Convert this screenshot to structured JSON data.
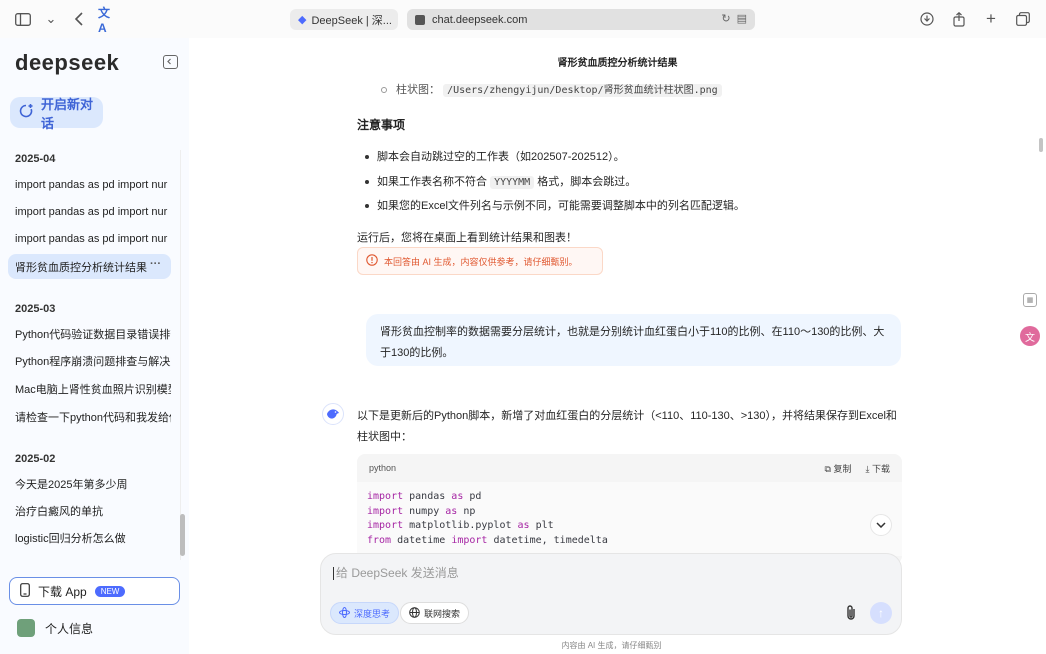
{
  "browser": {
    "tab_inactive_label": "DeepSeek | 深...",
    "tab_active_url": "chat.deepseek.com"
  },
  "sidebar": {
    "logo": "deepseek",
    "new_chat_label": "开启新对话",
    "groups": [
      {
        "title": "2025-04",
        "items": [
          "import pandas as pd import nur",
          "import pandas as pd import nur",
          "import pandas as pd import nur",
          "肾形贫血质控分析统计结果"
        ]
      },
      {
        "title": "2025-03",
        "items": [
          "Python代码验证数据目录错误排查",
          "Python程序崩溃问题排查与解决方",
          "Mac电脑上肾性贫血照片识别模型",
          "请检查一下python代码和我发给你"
        ]
      },
      {
        "title": "2025-02",
        "items": [
          "今天是2025年第多少周",
          "治疗白癜风的单抗",
          "logistic回归分析怎么做"
        ]
      }
    ],
    "active_more": "···",
    "download_app_label": "下载 App",
    "new_badge": "NEW",
    "profile_label": "个人信息"
  },
  "main": {
    "chat_title": "肾形贫血质控分析统计结果",
    "bar_chart_label": "柱状图：",
    "bar_chart_path": "/Users/zhengyijun/Desktop/肾形贫血统计柱状图.png",
    "notes_heading": "注意事项",
    "notes": [
      {
        "text_a": "脚本会自动跳过空的工作表（如202507-202512）。",
        "code": "",
        "text_b": ""
      },
      {
        "text_a": "如果工作表名称不符合 ",
        "code": "YYYYMM",
        "text_b": " 格式，脚本会跳过。"
      },
      {
        "text_a": "如果您的Excel文件列名与示例不同，可能需要调整脚本中的列名匹配逻辑。",
        "code": "",
        "text_b": ""
      }
    ],
    "after_run": "运行后，您将在桌面上看到统计结果和图表！",
    "ai_warning": "本回答由 AI 生成，内容仅供参考，请仔细甄别。",
    "user_message": "肾形贫血控制率的数据需要分层统计，也就是分别统计血红蛋白小于110的比例、在110～130的比例、大于130的比例。",
    "ai_intro": "以下是更新后的Python脚本，新增了对血红蛋白的分层统计（<110、110-130、>130），并将结果保存到Excel和柱状图中：",
    "code_lang": "python",
    "copy_label": "复制",
    "download_label": "下载",
    "code_lines": [
      {
        "kw1": "import",
        "mid": " pandas ",
        "kw2": "as",
        "rest": " pd"
      },
      {
        "kw1": "import",
        "mid": " numpy ",
        "kw2": "as",
        "rest": " np"
      },
      {
        "kw1": "import",
        "mid": " matplotlib.pyplot ",
        "kw2": "as",
        "rest": " plt"
      },
      {
        "kw1": "from",
        "mid": " datetime ",
        "kw2": "import",
        "rest": " datetime, timedelta"
      }
    ]
  },
  "input": {
    "placeholder": "给 DeepSeek 发送消息",
    "deep_think_label": "深度思考",
    "web_search_label": "联网搜索"
  },
  "footer_note": "内容由 AI 生成，请仔细甄别",
  "colors": {
    "accent": "#4d6bfe",
    "sidebar_bg": "#f9fbff",
    "active_item_bg": "#dbe8fd",
    "warning_text": "#e05830"
  }
}
